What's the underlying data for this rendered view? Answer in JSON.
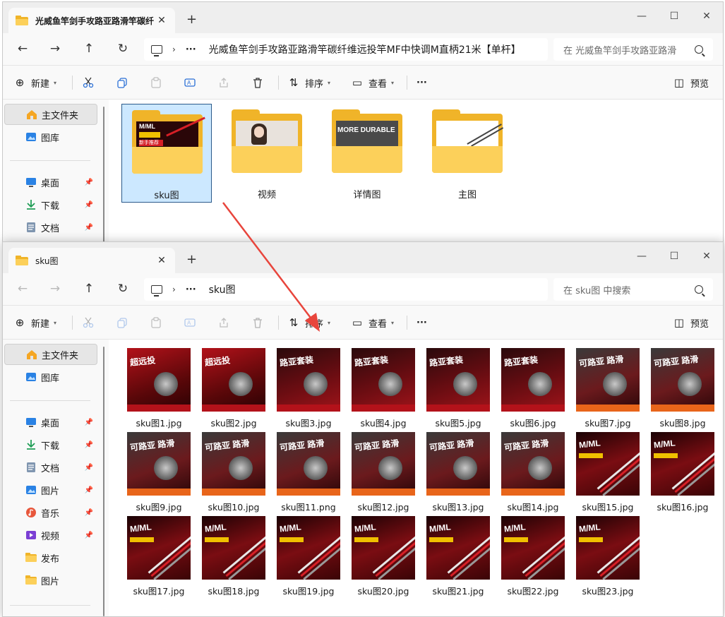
{
  "back_window": {
    "tab_title": "光威鱼竿剑手攻路亚路滑竿碳纤",
    "new_tab": "+",
    "controls": {
      "minimize": "—",
      "maximize": "☐",
      "close": "✕"
    },
    "address_path": "光威鱼竿剑手攻路亚路滑竿碳纤维远投竿MF中快调M直柄21米【单杆】",
    "address_dots": "···",
    "search_placeholder": "在 光威鱼竿剑手攻路亚路滑",
    "toolbar": {
      "new_label": "新建",
      "sort_label": "排序",
      "view_label": "查看",
      "more": "···",
      "preview_label": "预览"
    },
    "sidebar": [
      {
        "label": "主文件夹",
        "icon": "home-icon",
        "active": true
      },
      {
        "label": "图库",
        "icon": "gallery-icon"
      },
      {
        "label": "桌面",
        "icon": "desktop-icon",
        "pinned": true
      },
      {
        "label": "下载",
        "icon": "download-icon",
        "pinned": true
      },
      {
        "label": "文档",
        "icon": "document-icon",
        "pinned": true
      }
    ],
    "folders": [
      {
        "name": "sku图",
        "selected": true,
        "preview_text_1": "M/ML",
        "preview_text_2": "新手推荐"
      },
      {
        "name": "视频"
      },
      {
        "name": "详情图",
        "preview_text": "MORE DURABLE"
      },
      {
        "name": "主图"
      }
    ]
  },
  "front_window": {
    "tab_title": "sku图",
    "new_tab": "+",
    "controls": {
      "minimize": "—",
      "maximize": "☐",
      "close": "✕"
    },
    "address_path": "sku图",
    "address_dots": "···",
    "search_placeholder": "在 sku图 中搜索",
    "toolbar": {
      "new_label": "新建",
      "sort_label": "排序",
      "view_label": "查看",
      "more": "···",
      "preview_label": "预览"
    },
    "sidebar": [
      {
        "label": "主文件夹",
        "icon": "home-icon",
        "active": true
      },
      {
        "label": "图库",
        "icon": "gallery-icon"
      },
      {
        "label": "桌面",
        "icon": "desktop-icon",
        "pinned": true
      },
      {
        "label": "下载",
        "icon": "download-icon",
        "pinned": true
      },
      {
        "label": "文档",
        "icon": "document-icon",
        "pinned": true
      },
      {
        "label": "图片",
        "icon": "pictures-icon",
        "pinned": true
      },
      {
        "label": "音乐",
        "icon": "music-icon",
        "pinned": true
      },
      {
        "label": "视频",
        "icon": "video-icon",
        "pinned": true
      },
      {
        "label": "发布",
        "icon": "folder-icon"
      },
      {
        "label": "图片",
        "icon": "folder-icon"
      }
    ],
    "files": [
      {
        "name": "sku图1.jpg",
        "style": "reel",
        "headline": "超远投"
      },
      {
        "name": "sku图2.jpg",
        "style": "reel",
        "headline": "超远投"
      },
      {
        "name": "sku图3.jpg",
        "style": "spin",
        "headline": "路亚套装"
      },
      {
        "name": "sku图4.jpg",
        "style": "spin",
        "headline": "路亚套装"
      },
      {
        "name": "sku图5.jpg",
        "style": "spin",
        "headline": "路亚套装"
      },
      {
        "name": "sku图6.jpg",
        "style": "spin",
        "headline": "路亚套装"
      },
      {
        "name": "sku图7.jpg",
        "style": "cast",
        "headline": "可路亚 路滑"
      },
      {
        "name": "sku图8.jpg",
        "style": "cast",
        "headline": "可路亚 路滑"
      },
      {
        "name": "sku图9.jpg",
        "style": "cast",
        "headline": "可路亚 路滑"
      },
      {
        "name": "sku图10.jpg",
        "style": "cast",
        "headline": "可路亚 路滑"
      },
      {
        "name": "sku图11.png",
        "style": "cast",
        "headline": "可路亚 路滑"
      },
      {
        "name": "sku图12.jpg",
        "style": "cast",
        "headline": "可路亚 路滑"
      },
      {
        "name": "sku图13.jpg",
        "style": "cast",
        "headline": "可路亚 路滑"
      },
      {
        "name": "sku图14.jpg",
        "style": "cast",
        "headline": "可路亚 路滑"
      },
      {
        "name": "sku图15.jpg",
        "style": "rod",
        "headline": "M/ML"
      },
      {
        "name": "sku图16.jpg",
        "style": "rod",
        "headline": "M/ML"
      },
      {
        "name": "sku图17.jpg",
        "style": "rod",
        "headline": "M/ML"
      },
      {
        "name": "sku图18.jpg",
        "style": "rod",
        "headline": "M/ML"
      },
      {
        "name": "sku图19.jpg",
        "style": "rod",
        "headline": "M/ML"
      },
      {
        "name": "sku图20.jpg",
        "style": "rod",
        "headline": "M/ML"
      },
      {
        "name": "sku图21.jpg",
        "style": "rod",
        "headline": "M/ML"
      },
      {
        "name": "sku图22.jpg",
        "style": "rod",
        "headline": "M/ML"
      },
      {
        "name": "sku图23.jpg",
        "style": "rod",
        "headline": "M/ML"
      }
    ]
  },
  "colors": {
    "accent_arrow": "#e8453c",
    "selection_bg": "#cce8ff",
    "folder_yellow": "#f0b429",
    "thumb_red": "#7a0d12"
  }
}
